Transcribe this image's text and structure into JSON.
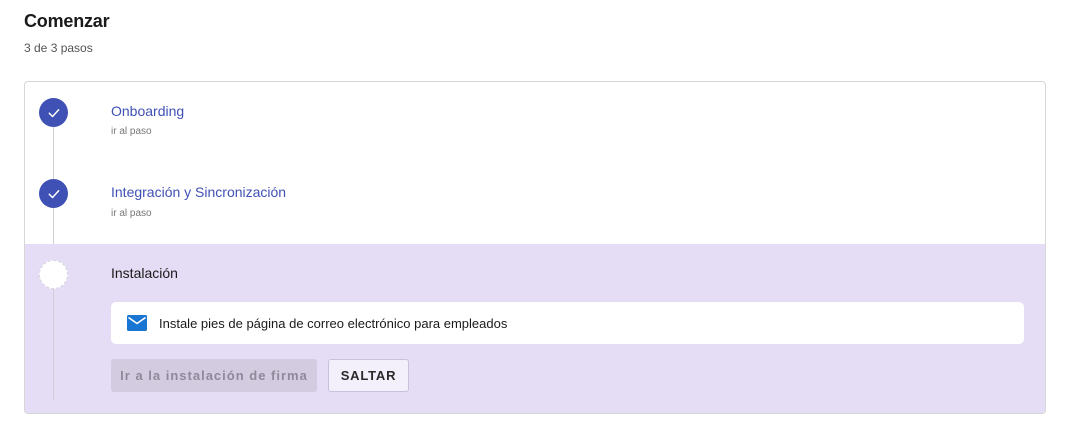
{
  "header": {
    "title": "Comenzar",
    "progress": "3 de 3 pasos"
  },
  "steps": [
    {
      "title": "Onboarding",
      "link": "ir al paso",
      "status": "completed",
      "icon": "check-icon"
    },
    {
      "title": "Integración y Sincronización",
      "link": "ir al paso",
      "status": "completed",
      "icon": "check-icon"
    },
    {
      "title": "Instalación",
      "status": "current",
      "task": {
        "icon": "mail-icon",
        "label": "Instale pies de página de correo electrónico para empleados"
      },
      "primary_button": "Ir a la instalación de firma",
      "secondary_button": "SALTAR"
    }
  ],
  "colors": {
    "accent": "#3f51b5",
    "active_step_bg": "#e5dcf5",
    "mail_icon": "#1976d2"
  }
}
